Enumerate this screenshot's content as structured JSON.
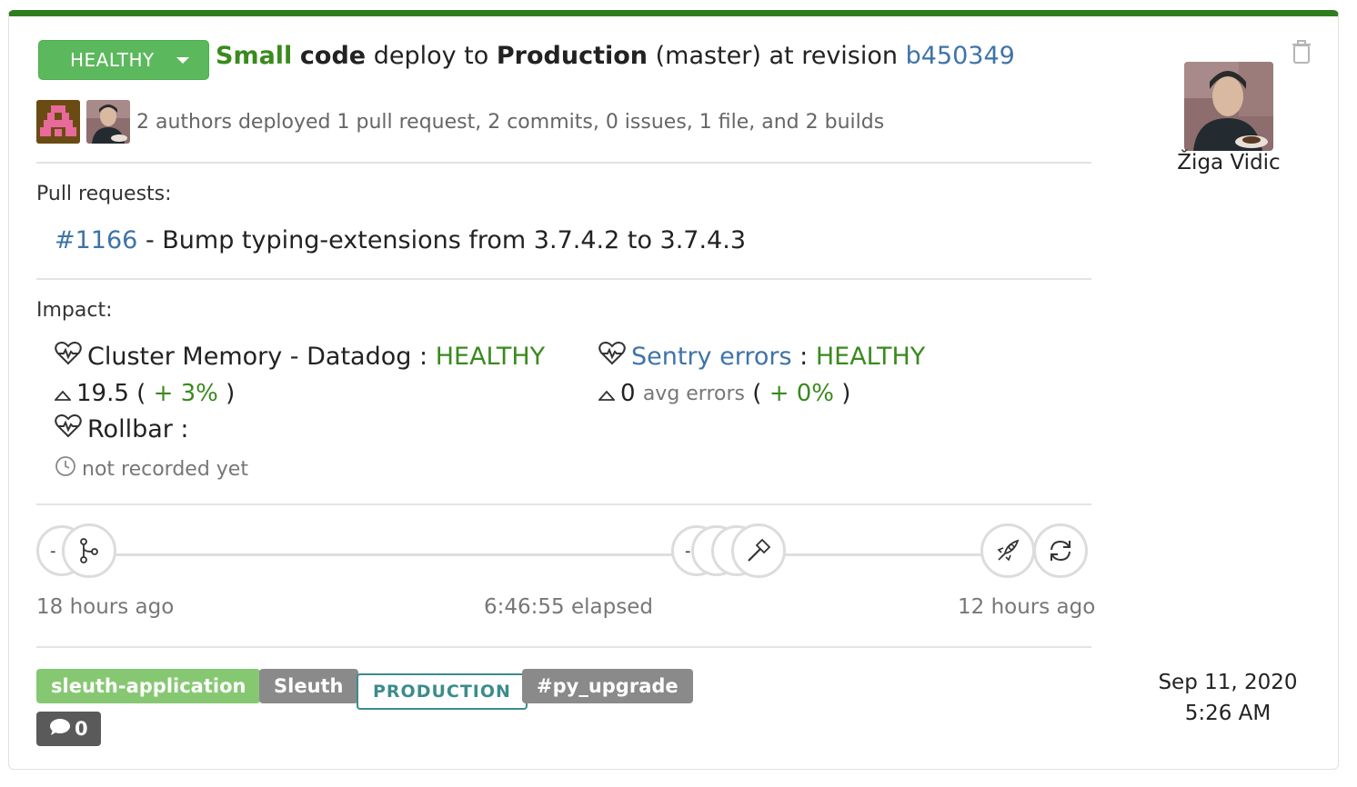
{
  "deploy": {
    "status": "HEALTHY",
    "size": "Small",
    "kind": "code",
    "deploy_to": "deploy to",
    "environment": "Production",
    "branch": "(master)",
    "at_revision": "at revision",
    "revision": "b450349"
  },
  "summary": "2 authors deployed 1 pull request, 2 commits, 0 issues, 1 file, and 2 builds",
  "pull_requests": {
    "label": "Pull requests:",
    "items": [
      {
        "number": "#1166",
        "title": "- Bump typing-extensions from 3.7.4.2 to 3.7.4.3"
      }
    ]
  },
  "impact": {
    "label": "Impact:",
    "cluster_memory": {
      "name": "Cluster Memory - Datadog",
      "sep": ":",
      "status": "HEALTHY",
      "value": "19.5",
      "open": "(",
      "change": "+ 3%",
      "close": ")"
    },
    "sentry": {
      "name": "Sentry errors",
      "sep": ":",
      "status": "HEALTHY",
      "value": "0",
      "unit": "avg errors",
      "open": "(",
      "change": "+ 0%",
      "close": ")"
    },
    "rollbar": {
      "name": "Rollbar :",
      "note": "not recorded yet"
    }
  },
  "timeline": {
    "start": "18 hours ago",
    "elapsed": "6:46:55 elapsed",
    "end": "12 hours ago",
    "dash": "-"
  },
  "tags": [
    "sleuth-application",
    "Sleuth",
    "PRODUCTION",
    "#py_upgrade"
  ],
  "comments": "0",
  "author": {
    "name": "Žiga Vidic"
  },
  "date": {
    "day": "Sep 11, 2020",
    "time": "5:26 AM"
  },
  "colors": {
    "accent_green": "#2f7d1e",
    "healthy": "#3a8a1e",
    "link": "#3f73a8",
    "tag_green": "#86c872",
    "tag_gray": "#8a8a8a",
    "tag_teal": "#3c8c8c"
  },
  "icons": {
    "status_caret": "chevron-down-icon",
    "trash": "trash-icon",
    "health": "heartbeat-icon",
    "delta": "triangle-up-icon",
    "clock": "clock-icon",
    "branch": "git-branch-icon",
    "hammer": "hammer-icon",
    "rocket": "rocket-icon",
    "sync": "sync-icon",
    "comment": "comment-icon"
  }
}
